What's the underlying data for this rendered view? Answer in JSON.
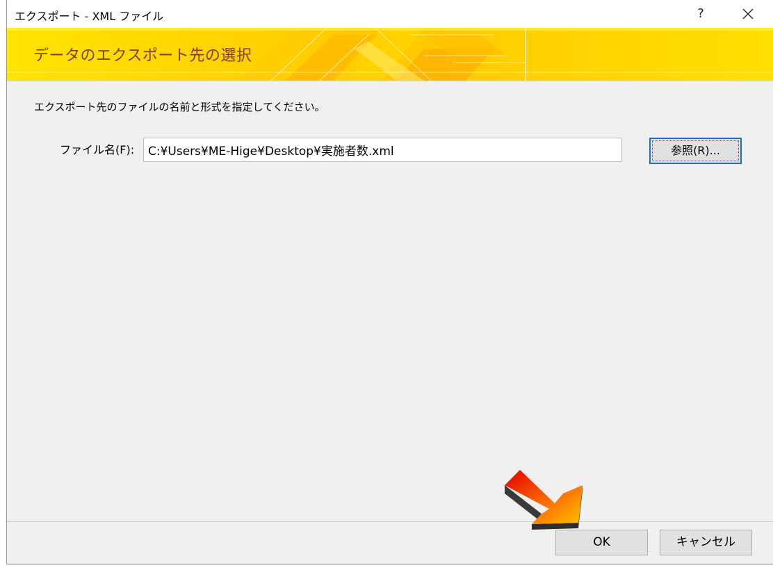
{
  "window": {
    "title": "エクスポート - XML ファイル",
    "help_label": "?"
  },
  "banner": {
    "title": "データのエクスポート先の選択"
  },
  "instruction": "エクスポート先のファイルの名前と形式を指定してください。",
  "file": {
    "label": "ファイル名(F):",
    "value": "C:¥Users¥ME-Hige¥Desktop¥実施者数.xml"
  },
  "buttons": {
    "browse": "参照(R)...",
    "ok": "OK",
    "cancel": "キャンセル"
  },
  "colors": {
    "banner": "#ffd800",
    "banner_title": "#8a3a12",
    "focus_border": "#1e6fc2",
    "arrow_start": "#e00000",
    "arrow_end": "#ffc000"
  },
  "icons": [
    "close-icon",
    "arrow-pointer-icon"
  ]
}
